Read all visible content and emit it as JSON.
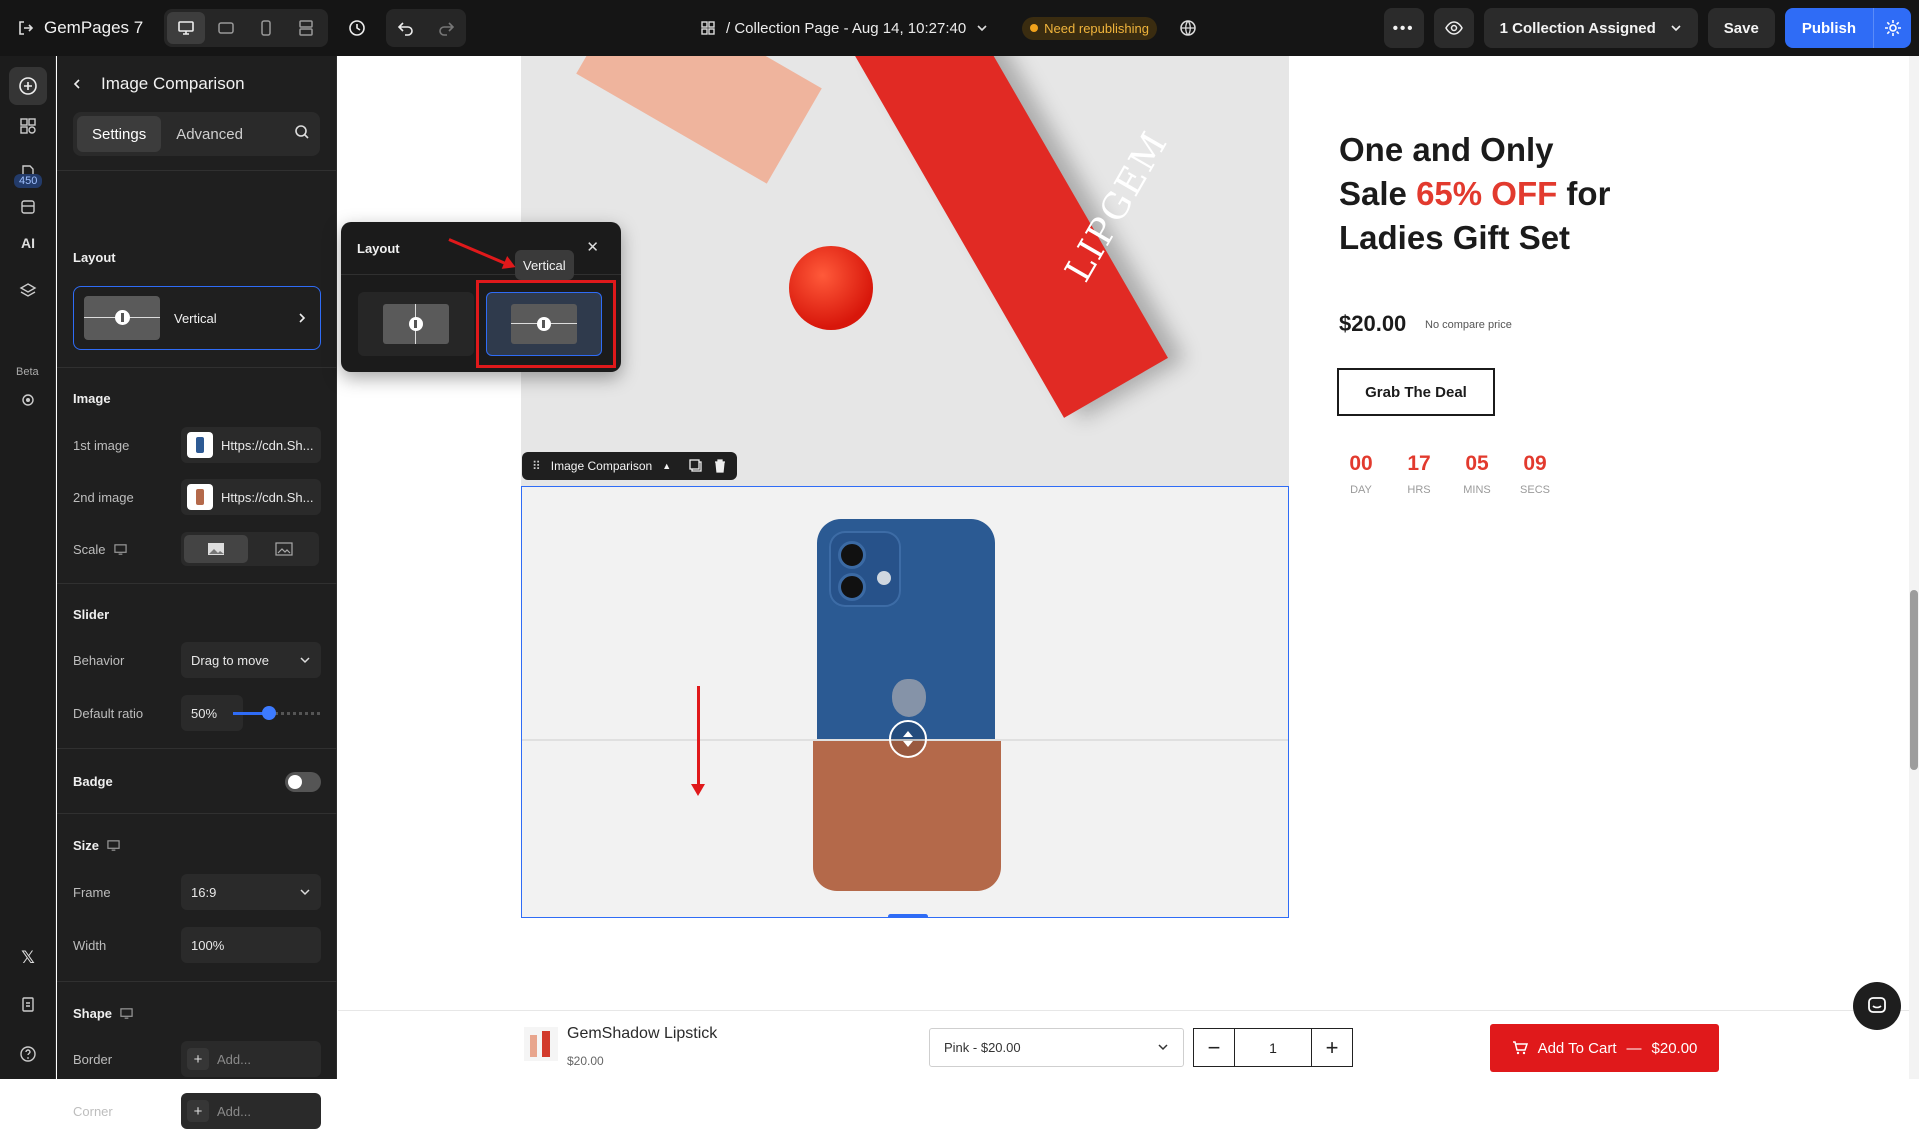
{
  "app": {
    "name": "GemPages 7"
  },
  "topbar": {
    "page_title": "/ Collection Page - Aug 14, 10:27:40",
    "status_badge": "Need republishing",
    "assigned": "1 Collection Assigned",
    "save": "Save",
    "publish": "Publish"
  },
  "rail": {
    "count_badge": "450",
    "beta_tag": "Beta",
    "ai_label": "AI"
  },
  "panel": {
    "title": "Image Comparison",
    "tabs": [
      "Settings",
      "Advanced"
    ],
    "layout": {
      "section": "Layout",
      "value": "Vertical"
    },
    "image": {
      "section": "Image",
      "first_label": "1st image",
      "first_value": "Https://cdn.Sh...",
      "second_label": "2nd image",
      "second_value": "Https://cdn.Sh...",
      "scale_label": "Scale"
    },
    "slider": {
      "section": "Slider",
      "behavior_label": "Behavior",
      "behavior_value": "Drag to move",
      "ratio_label": "Default ratio",
      "ratio_value": "50%",
      "ratio": 0.5
    },
    "badge": {
      "section": "Badge",
      "enabled": false
    },
    "size": {
      "section": "Size",
      "frame_label": "Frame",
      "frame_value": "16:9",
      "width_label": "Width",
      "width_value": "100%"
    },
    "shape": {
      "section": "Shape",
      "border_label": "Border",
      "border_value": "Add...",
      "corner_label": "Corner",
      "corner_value": "Add..."
    }
  },
  "popover": {
    "title": "Layout",
    "tooltip": "Vertical",
    "options": [
      "horizontal-layout",
      "vertical-layout"
    ],
    "selected": "vertical-layout"
  },
  "canvas": {
    "hero_brand": "LIPGEM",
    "element_label": "Image Comparison",
    "product": {
      "title_line1": "One and Only",
      "title_line2a": "Sale ",
      "title_highlight": "65% OFF",
      "title_line2b": " for",
      "title_line3": "Ladies Gift Set",
      "price": "$20.00",
      "compare": "No compare price",
      "cta": "Grab The Deal"
    },
    "countdown": [
      {
        "value": "00",
        "unit": "DAY"
      },
      {
        "value": "17",
        "unit": "HRS"
      },
      {
        "value": "05",
        "unit": "MINS"
      },
      {
        "value": "09",
        "unit": "SECS"
      }
    ]
  },
  "sticky": {
    "name": "GemShadow Lipstick",
    "price": "$20.00",
    "variant": "Pink - $20.00",
    "qty": "1",
    "cta": "Add To Cart",
    "cta_price": "$20.00"
  },
  "colors": {
    "accent": "#2f6cf6",
    "sale_red": "#e23a2e",
    "annotation_red": "#e0191b"
  }
}
